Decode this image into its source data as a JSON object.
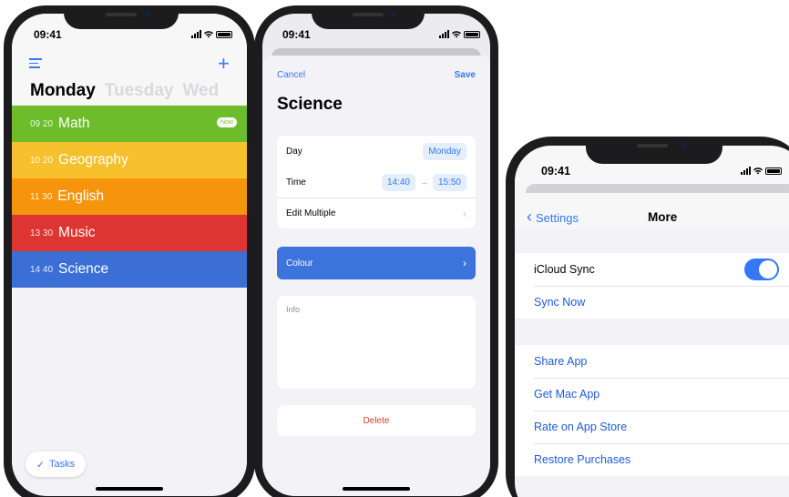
{
  "phones": [
    {
      "status": {
        "time": "09:41"
      },
      "header": {
        "days": [
          "Monday",
          "Tuesday",
          "Wed"
        ],
        "active_day": "Monday"
      },
      "lessons": [
        {
          "time": "09 20",
          "name": "Math",
          "color": "#6dbd2a",
          "badge": "Now"
        },
        {
          "time": "10 20",
          "name": "Geography",
          "color": "#f6c12c"
        },
        {
          "time": "11 30",
          "name": "English",
          "color": "#f6940d"
        },
        {
          "time": "13 30",
          "name": "Music",
          "color": "#dd3632"
        },
        {
          "time": "14 40",
          "name": "Science",
          "color": "#3b6fd6"
        }
      ],
      "footer": {
        "tasks_label": "Tasks"
      }
    },
    {
      "status": {
        "time": "09:41"
      },
      "toolbar": {
        "cancel": "Cancel",
        "save": "Save"
      },
      "title": "Science",
      "fields": {
        "day_label": "Day",
        "day_value": "Monday",
        "time_label": "Time",
        "time_start": "14:40",
        "time_end": "15:50",
        "edit_multiple": "Edit Multiple"
      },
      "colour": {
        "label": "Colour",
        "color": "#3d73dc"
      },
      "info_placeholder": "Info",
      "delete_label": "Delete"
    },
    {
      "status": {
        "time": "09:41"
      },
      "nav": {
        "back": "Settings",
        "title": "More"
      },
      "sync_group": [
        {
          "label": "iCloud Sync",
          "toggle": true
        },
        {
          "label": "Sync Now"
        }
      ],
      "links_group": [
        "Share App",
        "Get Mac App",
        "Rate on App Store",
        "Restore Purchases"
      ]
    }
  ],
  "colors": {
    "accent": "#3478f6",
    "destructive": "#e0392b"
  },
  "icons": [
    "hamburger-menu-icon",
    "plus-icon",
    "checkmark-icon",
    "chevron-right-icon",
    "chevron-left-icon",
    "arrow-right-icon",
    "signal-icon",
    "wifi-icon",
    "battery-icon"
  ]
}
